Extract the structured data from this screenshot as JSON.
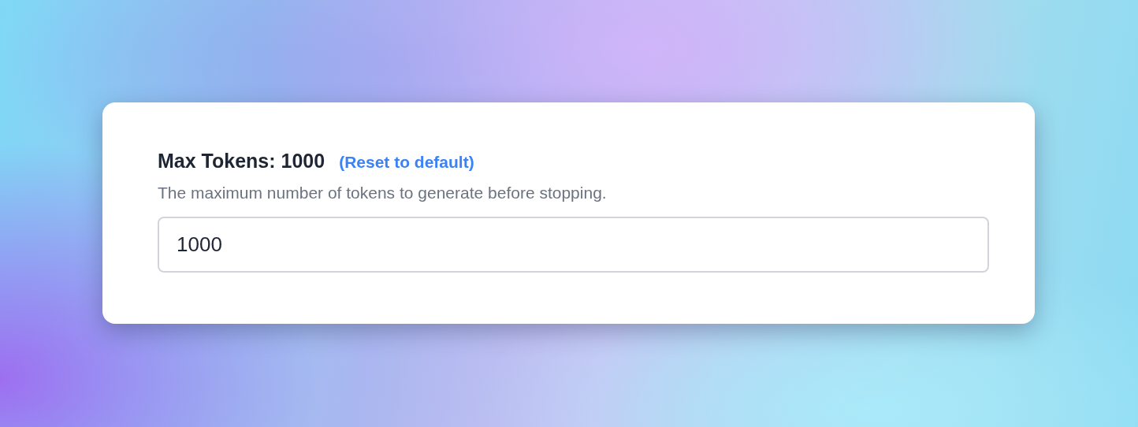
{
  "setting": {
    "label": "Max Tokens: 1000",
    "reset_link": "(Reset to default)",
    "description": "The maximum number of tokens to generate before stopping.",
    "input": {
      "value": "1000"
    }
  }
}
